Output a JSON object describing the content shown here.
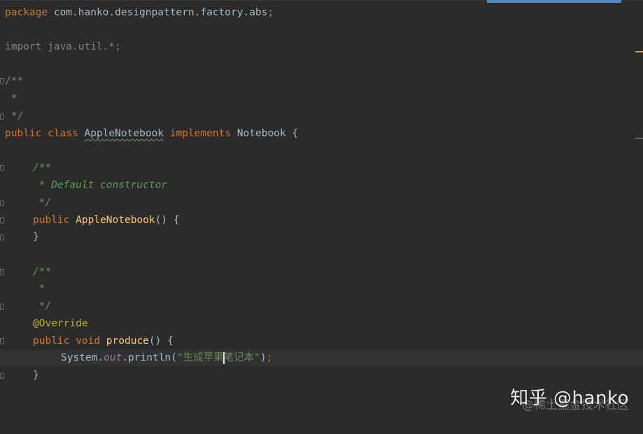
{
  "code": {
    "package_kw": "package",
    "package_name": " com.hanko.designpattern.factory.abs",
    "semi": ";",
    "import_line": "import java.util.*;",
    "cmt_open": "/**",
    "cmt_star": " *",
    "cmt_close": " */",
    "public_kw": "public",
    "class_kw": "class",
    "class_name": "AppleNotebook",
    "implements_kw": "implements",
    "iface_name": "Notebook",
    "open_brace": " {",
    "doc_open": "/**",
    "doc_default": " * Default constructor",
    "doc_star": " *",
    "doc_close": " */",
    "ctor_name": "AppleNotebook",
    "ctor_parens": "() {",
    "close_brace": "}",
    "override": "@Override",
    "void_kw": "void",
    "method_name": "produce",
    "method_parens": "() {",
    "system": "System.",
    "out": "out",
    "println": ".println(",
    "str_part1": "\"生成苹果",
    "str_part2": "笔记本\"",
    "call_end": ")",
    "call_semi": ";"
  },
  "watermark": {
    "main": "知乎 @hanko",
    "sub": "@稀土掘金技术社区"
  },
  "colors": {
    "background": "#2b2b2b",
    "keyword": "#cc7832",
    "doc_comment": "#629755",
    "method": "#ffc66d",
    "annotation": "#bbb529",
    "marker": "#e0a030"
  }
}
